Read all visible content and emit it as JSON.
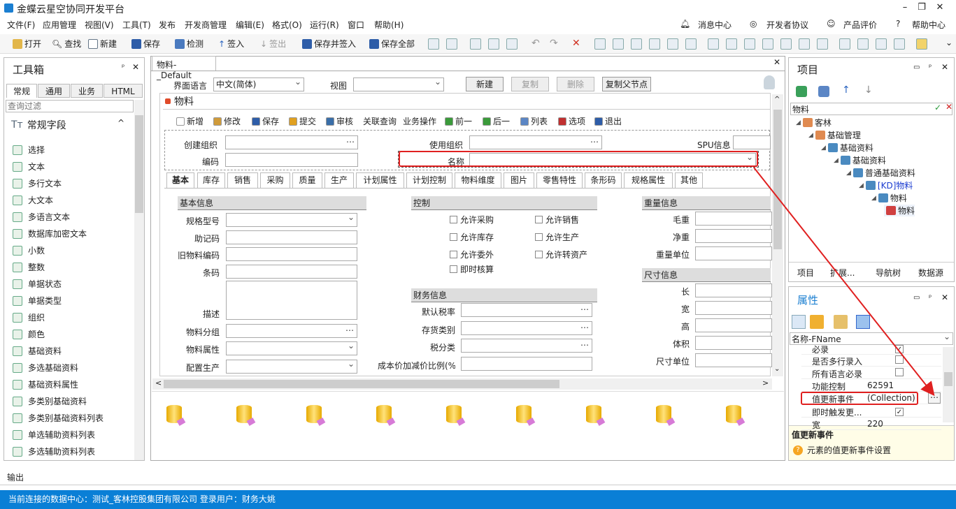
{
  "app": {
    "title": "金蝶云星空协同开发平台"
  },
  "menu": [
    "文件(F)",
    "应用管理",
    "视图(V)",
    "工具(T)",
    "发布",
    "开发商管理",
    "编辑(E)",
    "格式(O)",
    "运行(R)",
    "窗口",
    "帮助(H)"
  ],
  "topright": [
    "消息中心",
    "开发者协议",
    "产品评价",
    "帮助中心"
  ],
  "toolbar": [
    "打开",
    "查找",
    "新建",
    "保存",
    "检测",
    "签入",
    "签出",
    "保存并签入",
    "保存全部"
  ],
  "toolbox": {
    "title": "工具箱",
    "tabs": [
      "常规",
      "通用",
      "业务",
      "HTML"
    ],
    "filter_placeholder": "查询过滤",
    "section": "常规字段",
    "items": [
      "选择",
      "文本",
      "多行文本",
      "大文本",
      "多语言文本",
      "数据库加密文本",
      "小数",
      "整数",
      "单据状态",
      "单据类型",
      "组织",
      "颜色",
      "基础资料",
      "多选基础资料",
      "基础资料属性",
      "多类别基础资料",
      "多类别基础资料列表",
      "单选辅助资料列表",
      "多选辅助资料列表"
    ]
  },
  "doc": {
    "tab": "物料-_Default",
    "lang_label": "界面语言",
    "lang_value": "中文(简体)",
    "view_label": "视图",
    "buttons": [
      "新建",
      "复制",
      "删除",
      "复制父节点"
    ],
    "form_title": "物料",
    "form_toolbar": [
      "新增",
      "修改",
      "保存",
      "提交",
      "审核",
      "关联查询",
      "业务操作",
      "前一",
      "后一",
      "列表",
      "选项",
      "退出"
    ],
    "header_fields": {
      "create_org": "创建组织",
      "use_org": "使用组织",
      "spu": "SPU信息",
      "code": "编码",
      "name": "名称"
    },
    "tabs": [
      "基本",
      "库存",
      "销售",
      "采购",
      "质量",
      "生产",
      "计划属性",
      "计划控制",
      "物料维度",
      "图片",
      "零售特性",
      "条形码",
      "规格属性",
      "其他"
    ],
    "basic": {
      "title": "基本信息",
      "fields": [
        "规格型号",
        "助记码",
        "旧物料编码",
        "条码",
        "描述",
        "物料分组",
        "物料属性",
        "配置生产"
      ]
    },
    "control": {
      "title": "控制",
      "checks": [
        "允许采购",
        "允许销售",
        "允许库存",
        "允许生产",
        "允许委外",
        "允许转资产",
        "即时核算"
      ]
    },
    "finance": {
      "title": "财务信息",
      "fields": [
        "默认税率",
        "存货类别",
        "税分类",
        "成本价加减价比例(%)"
      ]
    },
    "weight": {
      "title": "重量信息",
      "fields": [
        "毛重",
        "净重",
        "重量单位"
      ]
    },
    "size": {
      "title": "尺寸信息",
      "fields": [
        "长",
        "宽",
        "高",
        "体积",
        "尺寸单位"
      ]
    }
  },
  "project": {
    "title": "项目",
    "search": "物料",
    "tree": [
      "客林",
      "基础管理",
      "基础资料",
      "基础资料",
      "普通基础资料",
      "[KD]物料",
      "物料",
      "物料"
    ],
    "bottom_tabs": [
      "项目",
      "扩展...",
      "导航树",
      "数据源"
    ]
  },
  "props": {
    "title": "属性",
    "selector": "名称-FName",
    "rows": [
      {
        "k": "必录",
        "v": ""
      },
      {
        "k": "是否多行录入",
        "v": ""
      },
      {
        "k": "所有语言必录",
        "v": ""
      },
      {
        "k": "功能控制",
        "v": "62591"
      },
      {
        "k": "值更新事件",
        "v": "(Collection)"
      },
      {
        "k": "即时触发更...",
        "v": ""
      },
      {
        "k": "宽",
        "v": "220"
      }
    ],
    "desc_title": "值更新事件",
    "desc": "元素的值更新事件设置"
  },
  "output": "输出",
  "status": "当前连接的数据中心：测试_客林控股集团有限公司   登录用户：财务大姚",
  "colors": {
    "accent": "#1b7fd1",
    "status_bg": "#0a7fd6",
    "highlight": "#e02020"
  }
}
